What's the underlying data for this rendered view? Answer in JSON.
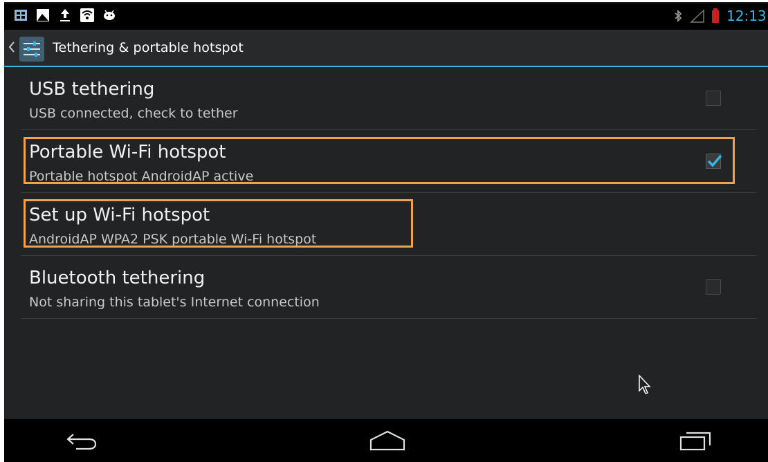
{
  "status_bar": {
    "notification_icons": [
      "gallery-icon",
      "image-icon",
      "upload-icon",
      "wifi-hotspot-icon",
      "android-icon"
    ],
    "system_icons": [
      "bluetooth-icon",
      "signal-icon",
      "battery-icon"
    ],
    "clock": "12:13"
  },
  "action_bar": {
    "app_icon": "settings-icon",
    "title": "Tethering & portable hotspot"
  },
  "settings": {
    "items": [
      {
        "title": "USB tethering",
        "summary": "USB connected, check to tether",
        "checked": false,
        "has_checkbox": true
      },
      {
        "title": "Portable Wi-Fi hotspot",
        "summary": "Portable hotspot AndroidAP active",
        "checked": true,
        "has_checkbox": true
      },
      {
        "title": "Set up Wi-Fi hotspot",
        "summary": "AndroidAP WPA2 PSK portable Wi-Fi hotspot",
        "has_checkbox": false
      },
      {
        "title": "Bluetooth tethering",
        "summary": "Not sharing this tablet's Internet connection",
        "checked": false,
        "has_checkbox": true
      }
    ]
  },
  "nav_bar": {
    "buttons": [
      "back-icon",
      "home-icon",
      "recent-apps-icon"
    ]
  },
  "colors": {
    "accent": "#33b5e5",
    "highlight": "#f0a34a",
    "background": "#222324"
  }
}
